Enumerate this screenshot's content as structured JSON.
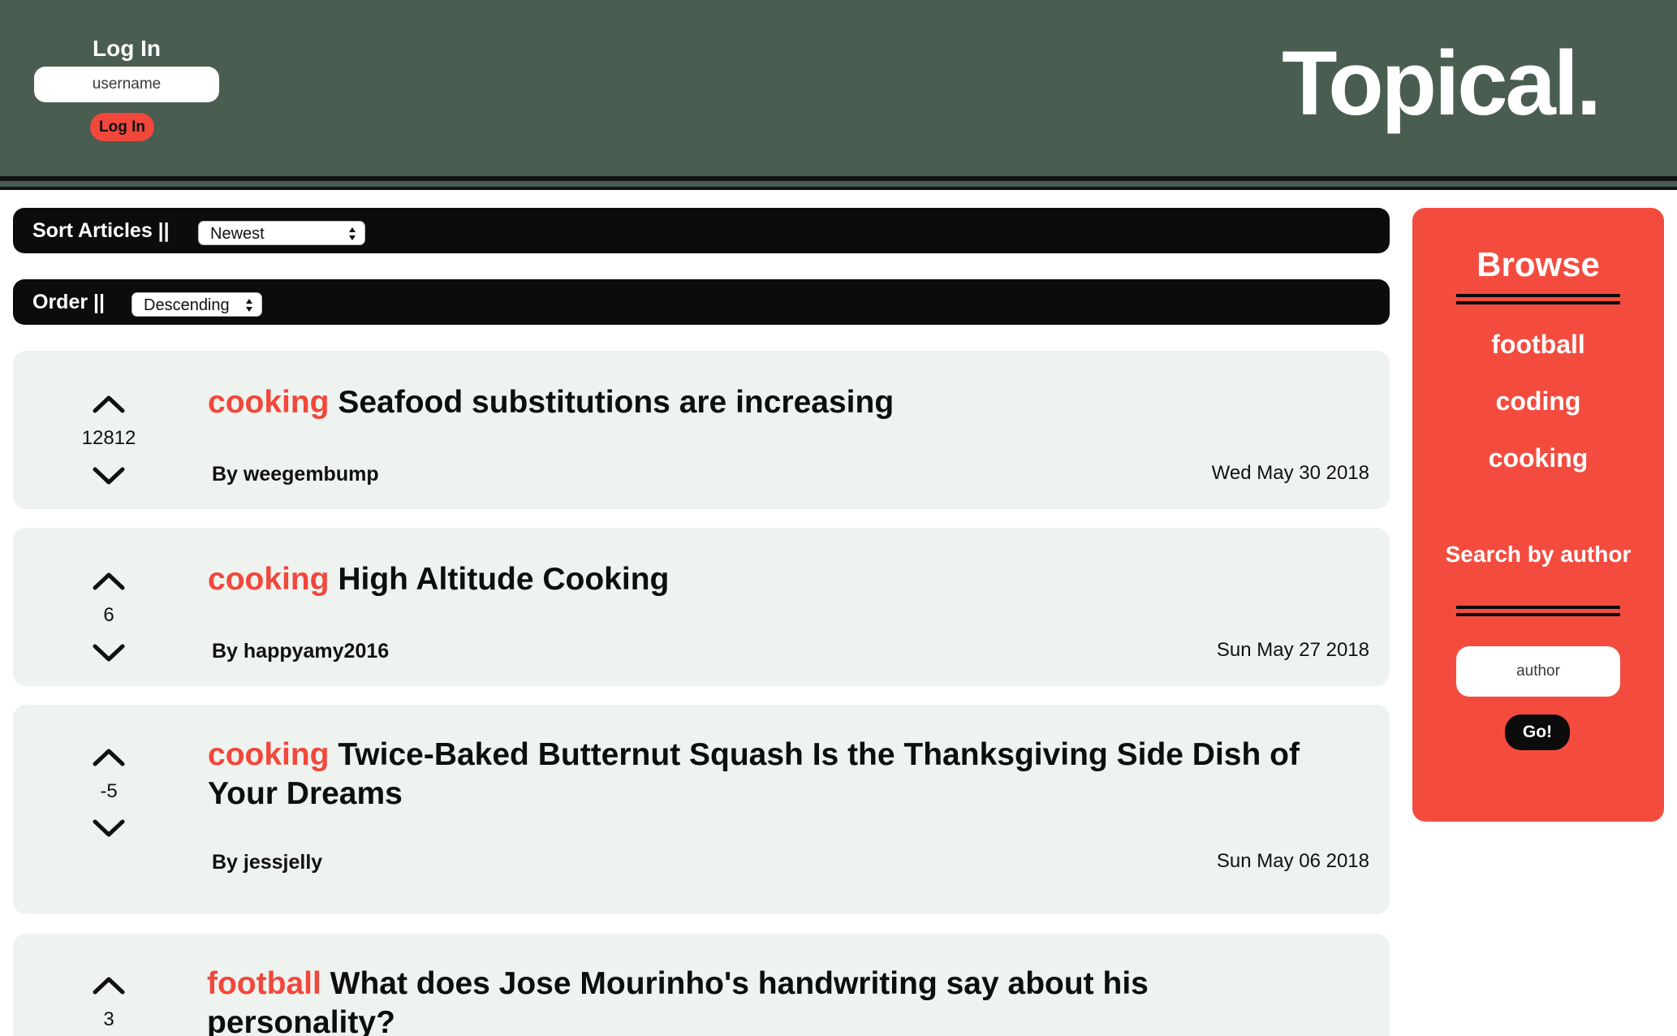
{
  "header": {
    "login_title": "Log In",
    "username_placeholder": "username",
    "login_button": "Log In",
    "brand": "Topical."
  },
  "controls": {
    "sort_label": "Sort Articles ||",
    "sort_value": "Newest",
    "order_label": "Order ||",
    "order_value": "Descending"
  },
  "articles": [
    {
      "topic": "cooking",
      "title": "Seafood substitutions are increasing",
      "votes": "12812",
      "author": "By weegembump",
      "date": "Wed May 30 2018"
    },
    {
      "topic": "cooking",
      "title": "High Altitude Cooking",
      "votes": "6",
      "author": "By happyamy2016",
      "date": "Sun May 27 2018"
    },
    {
      "topic": "cooking",
      "title": "Twice-Baked Butternut Squash Is the Thanksgiving Side Dish of Your Dreams",
      "votes": "-5",
      "author": "By jessjelly",
      "date": "Sun May 06 2018"
    },
    {
      "topic": "football",
      "title": "What does Jose Mourinho's handwriting say about his personality?",
      "votes": "3",
      "author": "",
      "date": ""
    }
  ],
  "sidebar": {
    "title": "Browse",
    "topics": [
      "football",
      "coding",
      "cooking"
    ],
    "search_title": "Search by author",
    "author_placeholder": "author",
    "go_button": "Go!"
  },
  "colors": {
    "header_bg": "#4a5d51",
    "accent": "#f2473b",
    "card_bg": "#eff3ef",
    "bar_bg": "#0b0c0b"
  },
  "icons": {
    "vote_up": "chevron-up-icon",
    "vote_down": "chevron-down-icon",
    "select_arrows": "select-arrows-icon"
  }
}
